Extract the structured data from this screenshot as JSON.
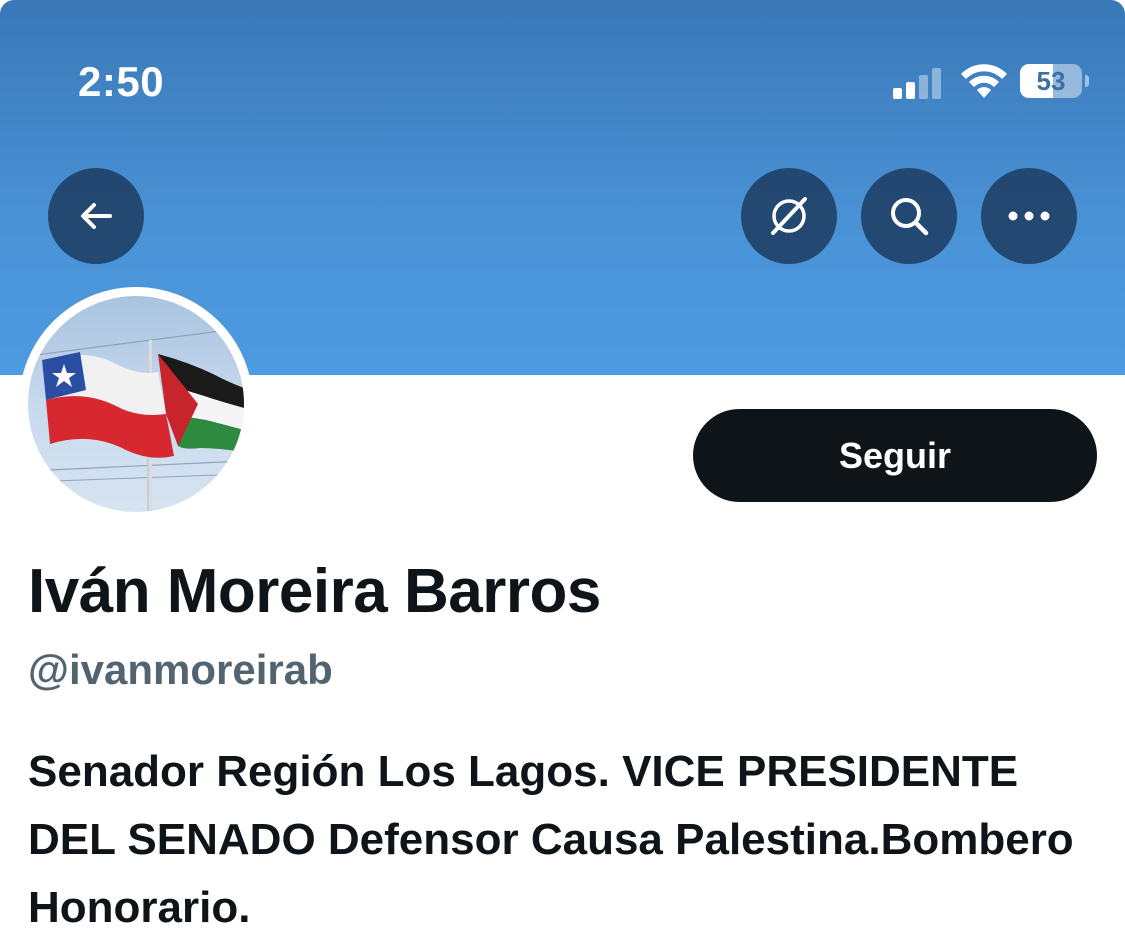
{
  "status_bar": {
    "time": "2:50",
    "battery_level": "53",
    "battery_fraction": 0.53,
    "signal_bars_active": 2,
    "icons": [
      "cellular-signal-icon",
      "wifi-icon",
      "battery-icon"
    ]
  },
  "header": {
    "back_icon": "arrow-left-icon",
    "action_icons": [
      "grok-icon",
      "search-icon",
      "more-icon"
    ]
  },
  "profile": {
    "avatar": "chile-palestine-flags",
    "follow_label": "Seguir",
    "display_name": "Iván Moreira Barros",
    "handle": "@ivanmoreirab",
    "bio": "Senador Región Los Lagos. VICE PRESIDENTE DEL SENADO Defensor Causa Palestina.Bombero Honorario."
  },
  "colors": {
    "banner": "#4a92d6",
    "follow_button": "#0f1419",
    "handle_text": "#536471",
    "body_text": "#0f1419"
  }
}
